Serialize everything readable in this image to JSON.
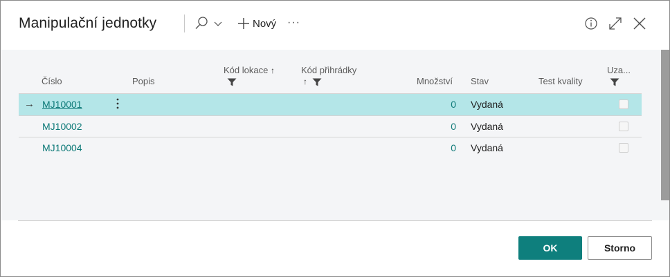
{
  "header": {
    "title": "Manipulační jednotky",
    "new_label": "Nový",
    "more_label": "···"
  },
  "columns": {
    "cislo": "Číslo",
    "popis": "Popis",
    "kod_lokace": "Kód lokace",
    "kod_prihradky": "Kód přihrádky",
    "mnozstvi": "Množství",
    "stav": "Stav",
    "test_kvality": "Test kvality",
    "uza": "Uza..."
  },
  "rows": [
    {
      "cislo": "MJ10001",
      "mnozstvi": "0",
      "stav": "Vydaná",
      "selected": true
    },
    {
      "cislo": "MJ10002",
      "mnozstvi": "0",
      "stav": "Vydaná",
      "selected": false
    },
    {
      "cislo": "MJ10004",
      "mnozstvi": "0",
      "stav": "Vydaná",
      "selected": false
    }
  ],
  "footer": {
    "ok_label": "OK",
    "cancel_label": "Storno"
  },
  "colors": {
    "accent": "#0e7f7d",
    "link": "#0e7a78",
    "selected_row": "#b4e6e8"
  }
}
